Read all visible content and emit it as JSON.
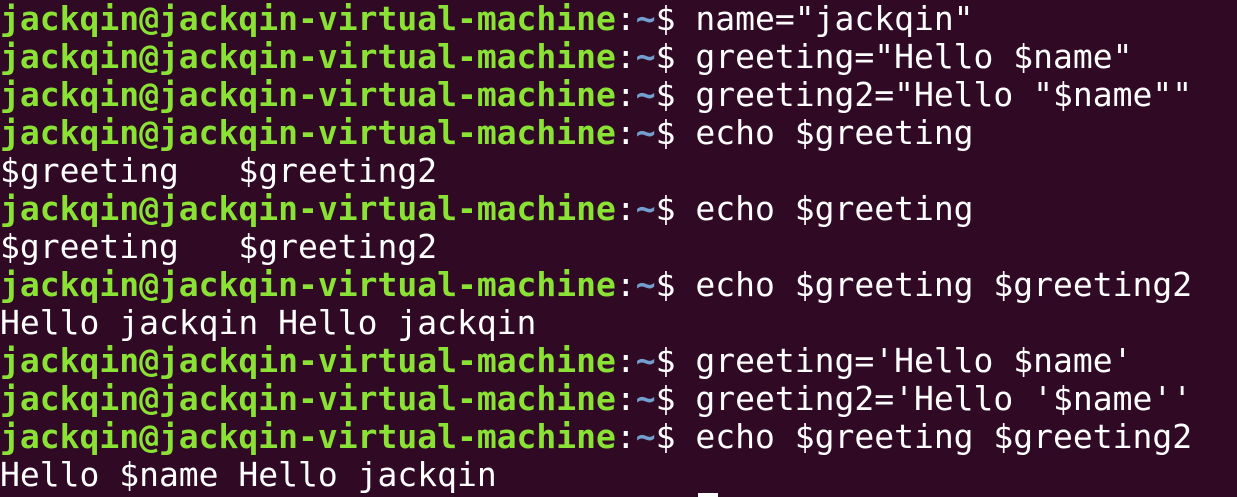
{
  "prompt": {
    "user_host": "jackqin@jackqin-virtual-machine",
    "colon": ":",
    "path": "~",
    "symbol": "$ "
  },
  "lines": [
    {
      "type": "cmd",
      "text": "name=\"jackqin\""
    },
    {
      "type": "cmd",
      "text": "greeting=\"Hello $name\""
    },
    {
      "type": "cmd",
      "text": "greeting2=\"Hello \"$name\"\""
    },
    {
      "type": "cmd",
      "text": "echo $greeting"
    },
    {
      "type": "out",
      "text": "$greeting   $greeting2"
    },
    {
      "type": "cmd",
      "text": "echo $greeting"
    },
    {
      "type": "out",
      "text": "$greeting   $greeting2"
    },
    {
      "type": "cmd",
      "text": "echo $greeting $greeting2"
    },
    {
      "type": "out",
      "text": "Hello jackqin Hello jackqin"
    },
    {
      "type": "cmd",
      "text": "greeting='Hello $name'"
    },
    {
      "type": "cmd",
      "text": "greeting2='Hello '$name''"
    },
    {
      "type": "cmd",
      "text": "echo $greeting $greeting2"
    },
    {
      "type": "out",
      "text": "Hello $name Hello jackqin"
    }
  ],
  "colors": {
    "background": "#300a24",
    "user_host": "#8ae234",
    "path": "#729fcf",
    "text": "#ffffff"
  }
}
